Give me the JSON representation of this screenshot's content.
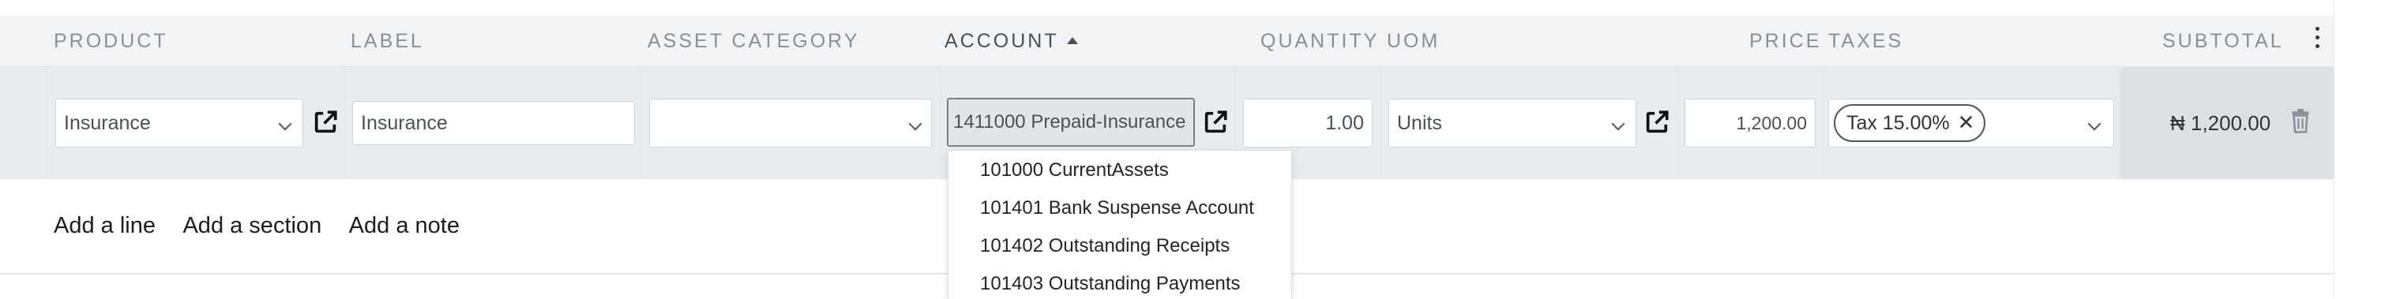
{
  "columns": {
    "product": "Product",
    "label": "Label",
    "asset_category": "Asset Category",
    "account": "Account",
    "quantity": "Quantity",
    "uom": "UoM",
    "price": "Price",
    "taxes": "Taxes",
    "subtotal": "Subtotal"
  },
  "sort": {
    "column": "account",
    "direction": "asc"
  },
  "line": {
    "product": "Insurance",
    "label": "Insurance",
    "asset_category": "",
    "account": "1411000 Prepaid-Insurance",
    "quantity": "1.00",
    "uom": "Units",
    "price": "1,200.00",
    "tax_tag": "Tax 15.00%",
    "subtotal": "₦ 1,200.00"
  },
  "actions": {
    "add_line": "Add a line",
    "add_section": "Add a section",
    "add_note": "Add a note"
  },
  "account_dropdown": {
    "options": [
      "101000 CurrentAssets",
      "101401 Bank Suspense Account",
      "101402 Outstanding Receipts",
      "101403 Outstanding Payments"
    ]
  },
  "icons": {
    "external_link": "external-link-icon",
    "dropdown_caret": "chevron-down-icon",
    "remove_tag": "close-icon",
    "delete": "trash-icon",
    "options_menu": "kebab-icon",
    "sort": "caret-up-icon"
  }
}
